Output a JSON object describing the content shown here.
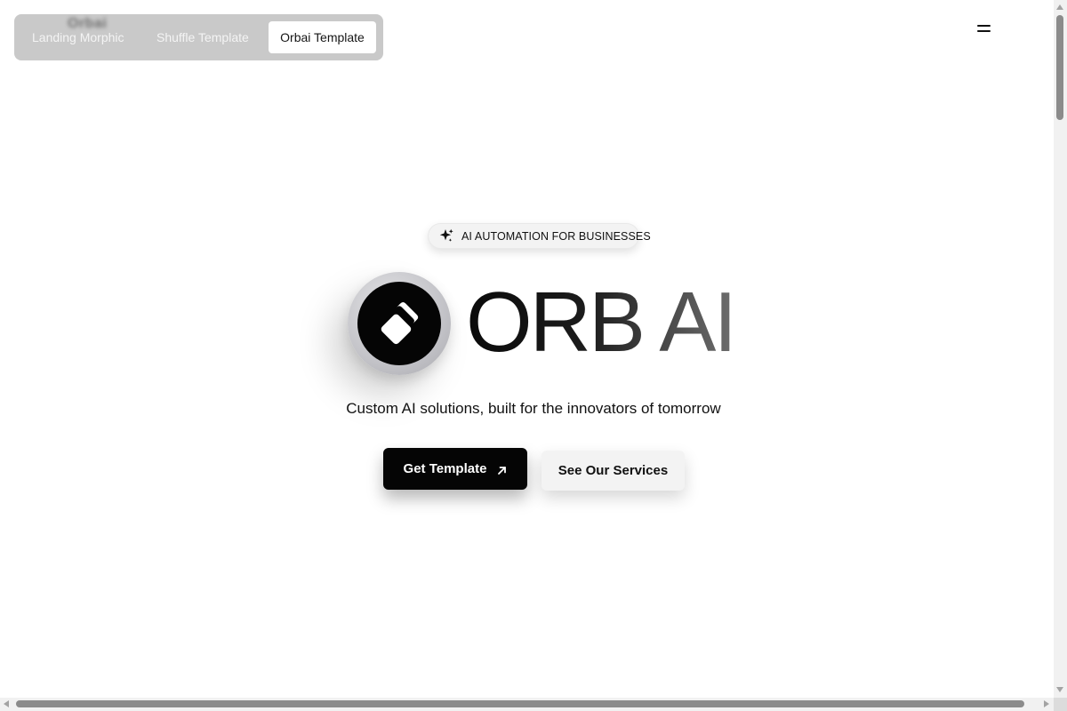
{
  "switcher": {
    "ghost_logo": "Orbai",
    "tabs": [
      {
        "label": "Landing Morphic",
        "active": false
      },
      {
        "label": "Shuffle Template",
        "active": false
      },
      {
        "label": "Orbai Template",
        "active": true
      }
    ]
  },
  "header": {
    "menu_icon": "hamburger-icon"
  },
  "hero": {
    "badge": {
      "icon": "sparkle-icon",
      "text": "AI AUTOMATION FOR BUSINESSES"
    },
    "logo_icon": "orb-logo-icon",
    "title": "ORB AI",
    "subtitle": "Custom AI solutions, built for the innovators of tomorrow",
    "primary_button": {
      "label": "Get Template",
      "icon": "arrow-up-right-icon"
    },
    "secondary_button": {
      "label": "See Our Services"
    }
  },
  "colors": {
    "background": "#ffffff",
    "switcher_bg": "#c9c9c9",
    "primary_button_bg": "#050505",
    "secondary_button_bg": "#f3f3f3",
    "scrollbar_thumb": "#8b8b8b"
  }
}
